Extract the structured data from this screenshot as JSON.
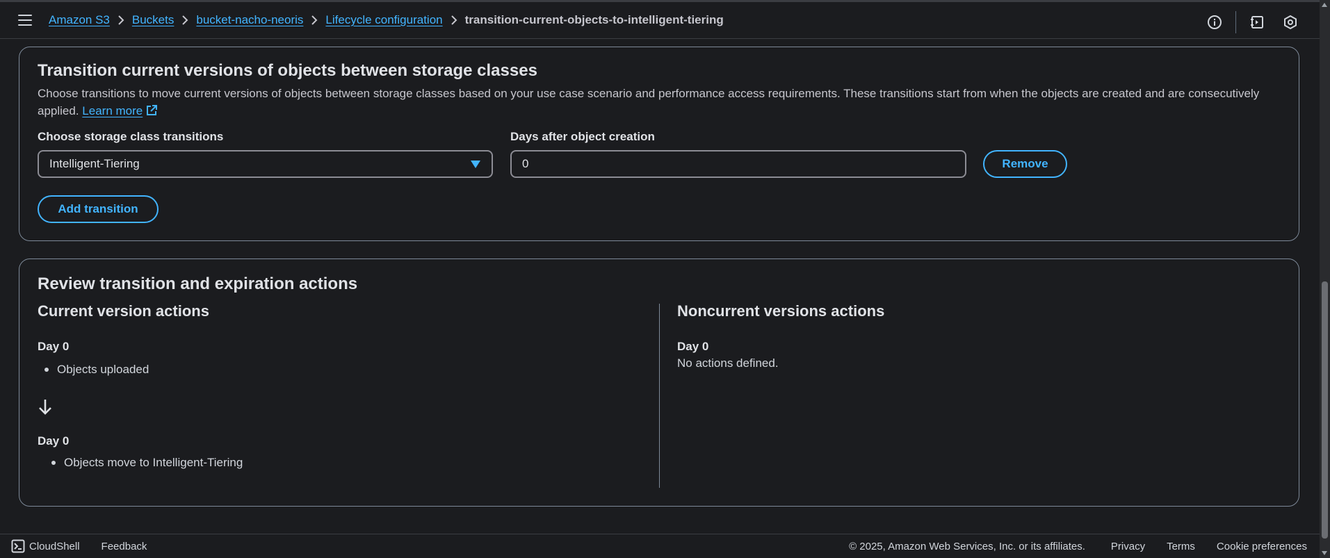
{
  "header": {
    "breadcrumbs": [
      {
        "label": "Amazon S3"
      },
      {
        "label": "Buckets"
      },
      {
        "label": "bucket-nacho-neoris"
      },
      {
        "label": "Lifecycle configuration"
      }
    ],
    "current": "transition-current-objects-to-intelligent-tiering",
    "icons": [
      "info-icon",
      "notes-icon",
      "settings-hex-icon"
    ]
  },
  "transitions": {
    "title": "Transition current versions of objects between storage classes",
    "description": "Choose transitions to move current versions of objects between storage classes based on your use case scenario and performance access requirements. These transitions start from when the objects are created and are consecutively applied.",
    "learn_more": "Learn more",
    "storage_class_label": "Choose storage class transitions",
    "storage_class_value": "Intelligent-Tiering",
    "days_label": "Days after object creation",
    "days_value": "0",
    "remove_label": "Remove",
    "add_label": "Add transition"
  },
  "review": {
    "title": "Review transition and expiration actions",
    "current": {
      "title": "Current version actions",
      "steps": [
        {
          "day": "Day 0",
          "item": "Objects uploaded"
        },
        {
          "day": "Day 0",
          "item": "Objects move to Intelligent-Tiering"
        }
      ]
    },
    "noncurrent": {
      "title": "Noncurrent versions actions",
      "day": "Day 0",
      "text": "No actions defined."
    }
  },
  "footer": {
    "cloudshell": "CloudShell",
    "feedback": "Feedback",
    "copyright": "© 2025, Amazon Web Services, Inc. or its affiliates.",
    "privacy": "Privacy",
    "terms": "Terms",
    "cookies": "Cookie preferences"
  },
  "colors": {
    "link": "#42b4ff",
    "background": "#1b1c1f",
    "border": "#7d8998"
  }
}
